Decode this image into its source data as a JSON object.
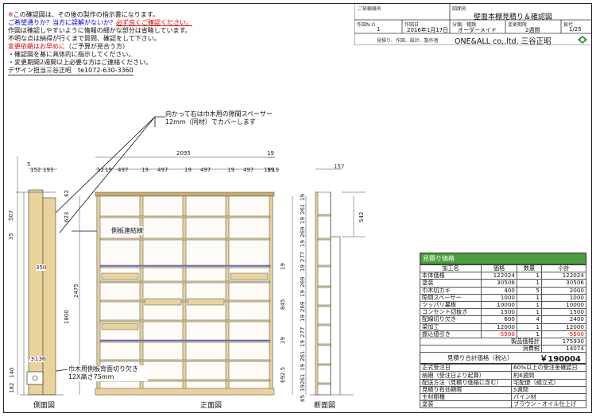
{
  "notes": {
    "line1_prefix": "※",
    "line1_text": "この確認図は、その後の製作の指示書になります。",
    "line2_blue": "ご希望通りか？当方に誤解がないか？",
    "line2_red": "必ず良くご確認ください。",
    "line3": "作図は確認しやすいように情報の細かな部分は省略しています。",
    "line4": "不明な点は納得が行くまで質問、確認をして下さい。",
    "line5_red": "変更依頼はお早めに",
    "line5_rest": "（ご予算が見合う方）",
    "line6": "・確認図を基に具体的に指示してください。",
    "line7": "・変更期間2週間以上必要な方はご連絡ください。",
    "line8": "デザイン担当三谷正昭　te1072-630-3360"
  },
  "title_block": {
    "customer_label": "ご依頼様名",
    "drawing_name_label": "図面名",
    "drawing_name": "壁面本棚見積り＆確認図",
    "drawing_no_label": "作図N.O",
    "drawing_no": "1",
    "date_label": "作図日",
    "date": "2016年1月17日",
    "type_label": "分類、種類",
    "type": "オーダーメイド",
    "change_label": "変更期限",
    "change": "2週間",
    "page_label": "頁代",
    "page": "1/25",
    "company_label": "見積り、作図、設計、製作者",
    "company": "ONE&ALL co,.ltd. 三谷正昭"
  },
  "callouts": {
    "top": "向かって右は巾木用の隙間スペーサー12mm（同材）でカバーします",
    "side_link": "側板連結線",
    "cutout": "巾木用側板背面切り欠き 12X高さ75mm"
  },
  "views": {
    "side": "側面図",
    "front": "正面図",
    "section": "断面図"
  },
  "dims": {
    "total_width": "2095",
    "top_left": [
      "5",
      "152",
      "193"
    ],
    "top_segments": [
      "12",
      "19",
      "497",
      "19",
      "497",
      "19",
      "497",
      "19",
      "497",
      "19",
      "19"
    ],
    "top_right": [
      "19",
      "19"
    ],
    "depth": "157",
    "side_vertical": [
      "507",
      "35",
      "62",
      "623",
      "350",
      "1800",
      "2475",
      "73",
      "136",
      "182",
      "140"
    ],
    "section_vertical": [
      "19",
      "261",
      "19",
      "269",
      "19",
      "277",
      "19",
      "269",
      "19",
      "269",
      "19",
      "277",
      "19",
      "261",
      "19",
      "261",
      "19",
      "65"
    ],
    "right_side": [
      "542"
    ],
    "mid_markers": [
      "19",
      "845",
      "19",
      "692.5"
    ]
  },
  "estimate": {
    "header": "見積り価格",
    "columns": [
      "加工名",
      "価格",
      "数量",
      "小計"
    ],
    "rows": [
      [
        "本体価格",
        "122024",
        "1",
        "122024"
      ],
      [
        "塗装",
        "30506",
        "1",
        "30506"
      ],
      [
        "巾木切カキ",
        "400",
        "5",
        "2000"
      ],
      [
        "隙間スペーサー",
        "1000",
        "1",
        "1000"
      ],
      [
        "ツッパリ幕板",
        "10000",
        "1",
        "10000"
      ],
      [
        "コンセント切抜き",
        "1500",
        "1",
        "1500"
      ],
      [
        "配線切り欠き",
        "600",
        "4",
        "2400"
      ],
      [
        "梁加工",
        "12000",
        "1",
        "12000"
      ],
      [
        "振込値引き",
        "-5500",
        "1",
        "-5500"
      ]
    ],
    "product_total_label": "製品価格計",
    "product_total": "175930",
    "tax_label": "消費税",
    "tax": "14074",
    "grand_label": "見積り合計価格（税込）",
    "grand": "￥190004",
    "info": [
      [
        "正式受注日",
        "60%以上の受注金確認日"
      ],
      [
        "納期（受注日より起算）",
        "約6週間"
      ],
      [
        "配送方法（見積り価格に含む）",
        "宅配便（組立式）"
      ],
      [
        "見積り有効期限",
        "5週間"
      ],
      [
        "主材樹種",
        "パイン材"
      ],
      [
        "塗装",
        "ブラウン・オイル仕上げ"
      ]
    ]
  },
  "colors": {
    "header_green": "#4aa03c",
    "wood": "#e9d39b",
    "wood_dark": "#c9ac68",
    "shelf_line": "#3a3ae0"
  },
  "icons": {
    "logo": "company-logo-icon"
  }
}
